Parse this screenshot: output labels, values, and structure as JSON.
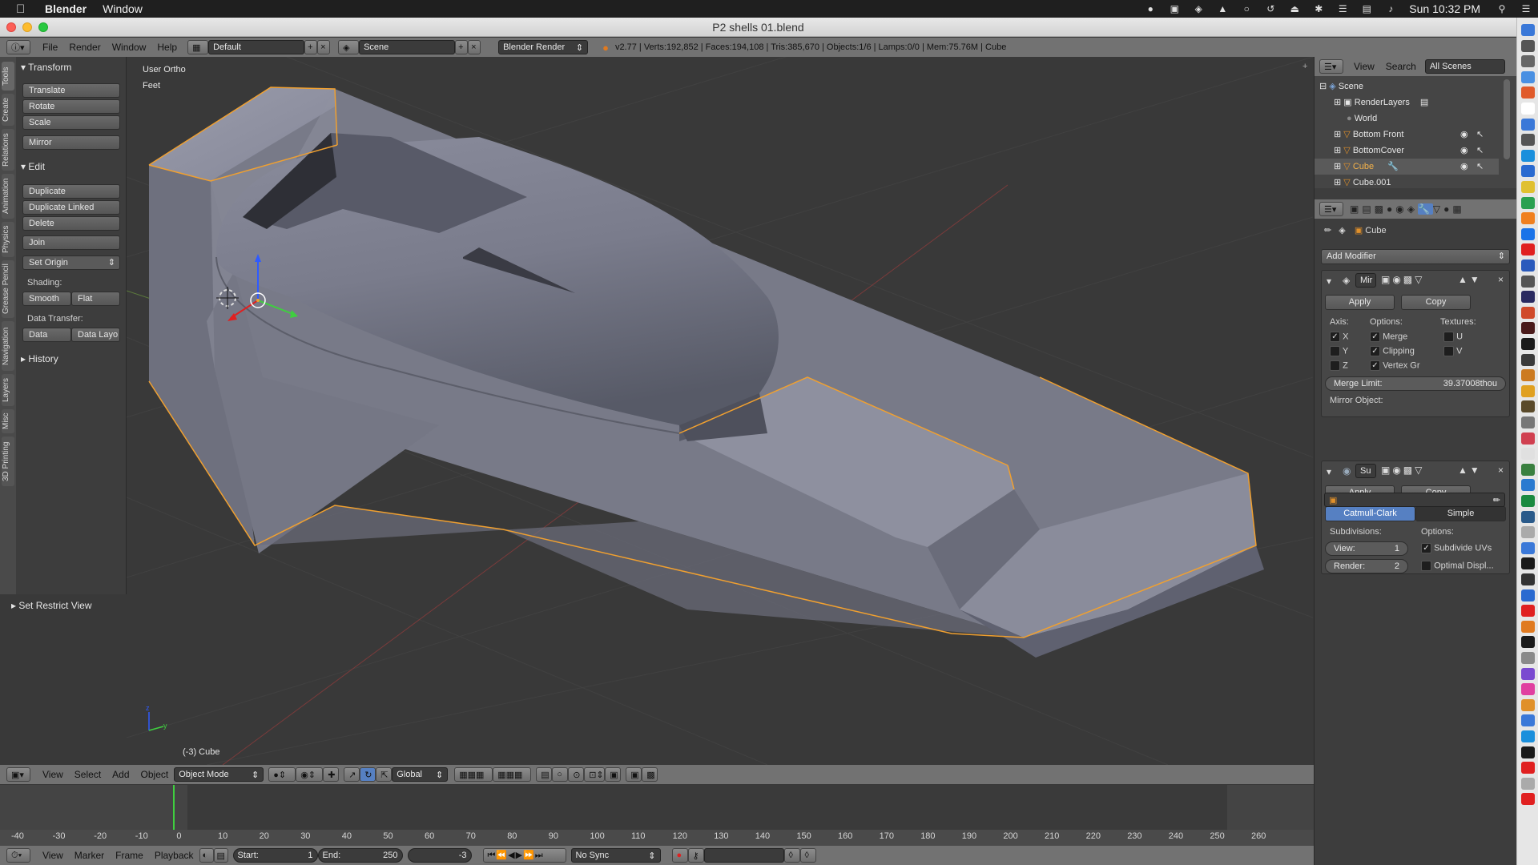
{
  "macbar": {
    "app": "Blender",
    "menu": "Window",
    "clock": "Sun 10:32 PM"
  },
  "window": {
    "title": "P2 shells 01.blend"
  },
  "infobar": {
    "menus": [
      "File",
      "Render",
      "Window",
      "Help"
    ],
    "layout": "Default",
    "scene": "Scene",
    "engine": "Blender Render",
    "stats": "v2.77 | Verts:192,852 | Faces:194,108 | Tris:385,670 | Objects:1/6 | Lamps:0/0 | Mem:75.76M | Cube"
  },
  "tool_tabs": [
    "Tools",
    "Create",
    "Relations",
    "Animation",
    "Physics",
    "Grease Pencil",
    "Navigation",
    "Layers",
    "Misc",
    "3D Printing"
  ],
  "toolshelf": {
    "transform_header": "Transform",
    "translate": "Translate",
    "rotate": "Rotate",
    "scale": "Scale",
    "mirror": "Mirror",
    "edit_header": "Edit",
    "duplicate": "Duplicate",
    "duplicate_linked": "Duplicate Linked",
    "delete": "Delete",
    "join": "Join",
    "set_origin": "Set Origin",
    "shading_label": "Shading:",
    "smooth": "Smooth",
    "flat": "Flat",
    "data_transfer_label": "Data Transfer:",
    "data": "Data",
    "data_layo": "Data Layo",
    "history": "History",
    "restrict": "Set Restrict View"
  },
  "viewport": {
    "view_name": "User Ortho",
    "units": "Feet",
    "object_label": "(-3) Cube"
  },
  "viewport_header": {
    "menus": [
      "View",
      "Select",
      "Add",
      "Object"
    ],
    "mode": "Object Mode",
    "orientation": "Global"
  },
  "outliner": {
    "menus": [
      "View",
      "Search"
    ],
    "filter": "All Scenes",
    "items": [
      "Scene",
      "RenderLayers",
      "World",
      "Bottom Front",
      "BottomCover",
      "Cube",
      "Cube.001"
    ]
  },
  "properties": {
    "object_name": "Cube",
    "add_modifier": "Add Modifier",
    "mirror": {
      "name": "Mir",
      "apply": "Apply",
      "copy": "Copy",
      "axis_label": "Axis:",
      "options_label": "Options:",
      "textures_label": "Textures:",
      "x": "X",
      "y": "Y",
      "z": "Z",
      "merge": "Merge",
      "clipping": "Clipping",
      "vertex_gr": "Vertex Gr",
      "u": "U",
      "v": "V",
      "merge_limit_label": "Merge Limit:",
      "merge_limit_value": "39.37008thou",
      "mirror_object_label": "Mirror Object:"
    },
    "subsurf": {
      "name": "Su",
      "apply": "Apply",
      "copy": "Copy",
      "catmull": "Catmull-Clark",
      "simple": "Simple",
      "subdivisions_label": "Subdivisions:",
      "options_label": "Options:",
      "view_label": "View:",
      "view_value": "1",
      "render_label": "Render:",
      "render_value": "2",
      "subdivide_uvs": "Subdivide UVs",
      "optimal_display": "Optimal Displ..."
    }
  },
  "timeline": {
    "ticks": [
      "-40",
      "-30",
      "-20",
      "-10",
      "0",
      "10",
      "20",
      "30",
      "40",
      "50",
      "60",
      "70",
      "80",
      "90",
      "100",
      "110",
      "120",
      "130",
      "140",
      "150",
      "160",
      "170",
      "180",
      "190",
      "200",
      "210",
      "220",
      "230",
      "240",
      "250",
      "260"
    ],
    "menus": [
      "View",
      "Marker",
      "Frame",
      "Playback"
    ],
    "start_label": "Start:",
    "start_value": "1",
    "end_label": "End:",
    "end_value": "250",
    "current_frame": "-3",
    "sync": "No Sync"
  },
  "colors": {
    "selection": "#f0a030",
    "active_tab": "#5680c2",
    "mesh": "#8a8c9a"
  }
}
